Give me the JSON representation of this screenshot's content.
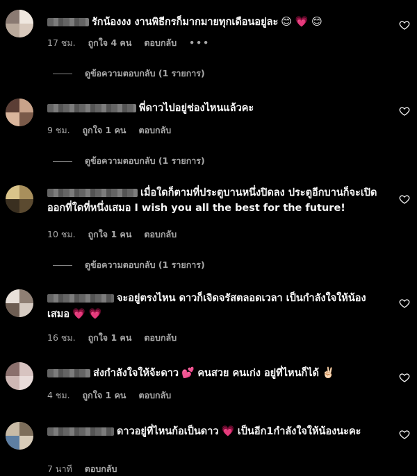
{
  "comments": [
    {
      "text": "รักน้องงง งานพิธีกรก็มากมายทุกเดือนอยู่ละ",
      "emoji": "😊 💗 😊",
      "time": "17 ชม.",
      "likes": "ถูกใจ 4 คน",
      "reply": "ตอบกลับ",
      "more": "•••",
      "view_replies": "ดูข้อความตอบกลับ (1 รายการ)"
    },
    {
      "text": "พี่ดาวไปอยู่ช่องไหนแล้วคะ",
      "emoji": "",
      "time": "9 ชม.",
      "likes": "ถูกใจ 1 คน",
      "reply": "ตอบกลับ",
      "view_replies": "ดูข้อความตอบกลับ (1 รายการ)"
    },
    {
      "text": "เมื่อใดก็ตามที่ประตูบานหนึ่งปิดลง ประตูอีกบานก็จะเปิดออกที่ใดที่หนึ่งเสมอ I wish you all the best for the future!",
      "emoji": "",
      "time": "10 ชม.",
      "likes": "ถูกใจ 1 คน",
      "reply": "ตอบกลับ",
      "view_replies": "ดูข้อความตอบกลับ (1 รายการ)"
    },
    {
      "text": "จะอยู่ตรงไหน ดาวก็เจิดจรัสตลอดเวลา เป็นกำลังใจให้น้องเสมอ",
      "emoji": "💗 💗",
      "time": "16 ชม.",
      "likes": "ถูกใจ 1 คน",
      "reply": "ตอบกลับ"
    },
    {
      "text": "ส่งกำลังใจให้จ้ะดาว",
      "emoji2": "💕",
      "text2": "คนสวย คนเก่ง อยู่ที่ไหนก็ได้",
      "emoji": "✌🏻",
      "time": "4 ชม.",
      "likes": "ถูกใจ 1 คน",
      "reply": "ตอบกลับ"
    },
    {
      "text": "ดาวอยู่ที่ไหนก้อเป็นดาว",
      "emoji2": "💗",
      "text2": "เป็นอีก1กำลังใจให้น้องนะคะ",
      "time": "7 นาที",
      "reply": "ตอบกลับ"
    }
  ],
  "icons": {
    "like": "heart-outline-icon"
  },
  "colors": {
    "background": "#000000",
    "text": "#f5f5f5",
    "muted": "#a8a8a8"
  }
}
